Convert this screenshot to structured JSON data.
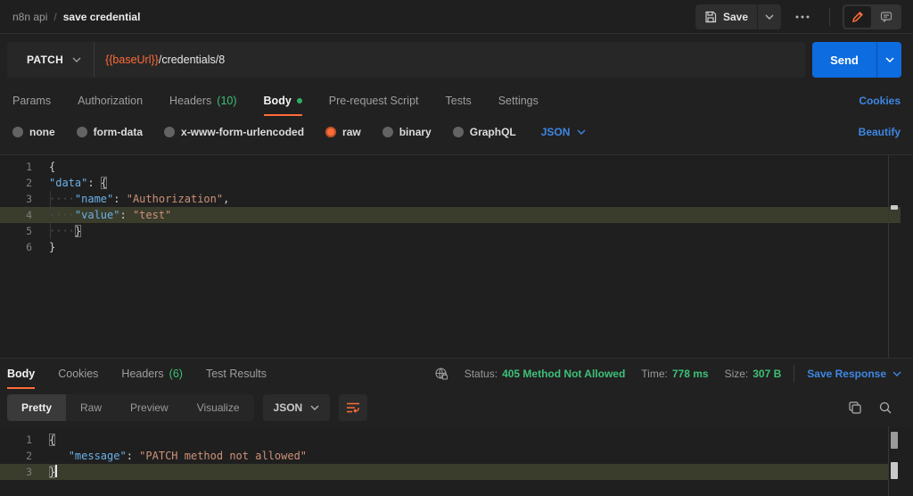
{
  "topbar": {
    "breadcrumb_parent": "n8n api",
    "breadcrumb_sep": "/",
    "breadcrumb_current": "save credential",
    "save_label": "Save"
  },
  "request": {
    "method": "PATCH",
    "url_var": "{{baseUrl}}",
    "url_path": "/credentials/8",
    "send_label": "Send"
  },
  "req_tabs": {
    "params": "Params",
    "auth": "Authorization",
    "headers": "Headers",
    "headers_count": "(10)",
    "body": "Body",
    "prescript": "Pre-request Script",
    "tests": "Tests",
    "settings": "Settings",
    "cookies_link": "Cookies"
  },
  "body_row": {
    "none": "none",
    "form_data": "form-data",
    "urlencoded": "x-www-form-urlencoded",
    "raw": "raw",
    "binary": "binary",
    "graphql": "GraphQL",
    "format": "JSON",
    "beautify_link": "Beautify"
  },
  "request_editor": {
    "lines": [
      {
        "num": "1",
        "brace": "{"
      },
      {
        "num": "2",
        "key": "\"data\"",
        "colon": ": ",
        "open": "{"
      },
      {
        "num": "3",
        "ws": "····",
        "key": "\"name\"",
        "colon": ": ",
        "str": "\"Authorization\"",
        "comma": ","
      },
      {
        "num": "4",
        "ws": "····",
        "key": "\"value\"",
        "colon": ": ",
        "str": "\"test\""
      },
      {
        "num": "5",
        "ws": "····",
        "close": "}"
      },
      {
        "num": "6",
        "brace": "}"
      }
    ]
  },
  "res_tabs": {
    "body": "Body",
    "cookies": "Cookies",
    "headers": "Headers",
    "headers_count": "(6)",
    "test_results": "Test Results"
  },
  "res_meta": {
    "status_label": "Status:",
    "status_value": "405 Method Not Allowed",
    "time_label": "Time:",
    "time_value": "778 ms",
    "size_label": "Size:",
    "size_value": "307 B",
    "save_response": "Save Response"
  },
  "res_toolbar": {
    "pretty": "Pretty",
    "raw": "Raw",
    "preview": "Preview",
    "visualize": "Visualize",
    "format": "JSON"
  },
  "response_editor": {
    "lines": [
      {
        "num": "1",
        "brace": "{"
      },
      {
        "num": "2",
        "ws": "   ",
        "key": "\"message\"",
        "colon": ": ",
        "str": "\"PATCH method not allowed\""
      },
      {
        "num": "3",
        "brace": "}"
      }
    ]
  },
  "colors": {
    "accent_orange": "#ff6c37",
    "link_blue": "#3d87e4",
    "success_green": "#3ec078",
    "send_blue": "#0c6ce0"
  }
}
